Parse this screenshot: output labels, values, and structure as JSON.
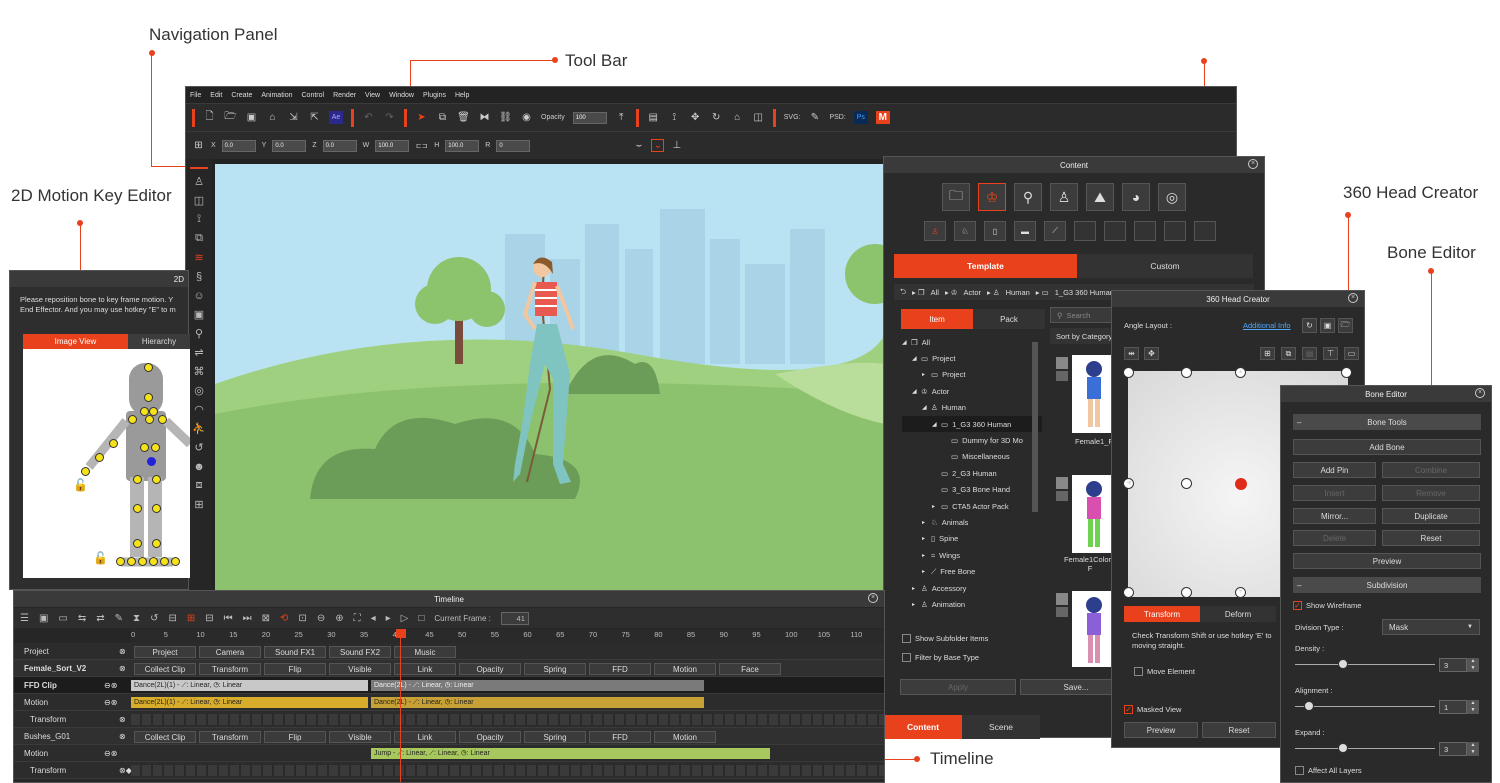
{
  "callouts": {
    "navigation_panel": "Navigation Panel",
    "tool_bar": "Tool Bar",
    "motion_key_editor": "2D Motion Key Editor",
    "head_creator": "360 Head Creator",
    "bone_editor": "Bone Editor",
    "timeline": "Timeline"
  },
  "menu": [
    "File",
    "Edit",
    "Create",
    "Animation",
    "Control",
    "Render",
    "View",
    "Window",
    "Plugins",
    "Help"
  ],
  "toolbar": {
    "opacity_label": "Opacity",
    "opacity_value": "100",
    "svg_label": "SVG:",
    "psd_label": "PSD:",
    "ae_label": "Ae",
    "ps_label": "Ps"
  },
  "transform": {
    "x_label": "X",
    "x_value": "0.0",
    "y_label": "Y",
    "y_value": "0.0",
    "z_label": "Z",
    "z_value": "0.0",
    "w_label": "W",
    "w_value": "100.0",
    "h_label": "H",
    "h_value": "100.0",
    "r_label": "R",
    "r_value": "0"
  },
  "motion_editor": {
    "title": "2D",
    "instruction": "Please reposition bone to key frame motion. Y\nEnd Effector. And you may use hotkey \"E\" to m",
    "tabs": [
      "Image View",
      "Hierarchy"
    ]
  },
  "content": {
    "title": "Content",
    "tabs": [
      "Template",
      "Custom"
    ],
    "breadcrumb": [
      "All",
      "Actor",
      "Human",
      "1_G3 360 Human"
    ],
    "subtabs": [
      "Item",
      "Pack"
    ],
    "search_placeholder": "Search",
    "sort_label": "Sort by Category",
    "tree": [
      {
        "label": "All",
        "indent": 0,
        "arrow": "◢",
        "icon": "❐"
      },
      {
        "label": "Project",
        "indent": 1,
        "arrow": "◢",
        "icon": "▭"
      },
      {
        "label": "Project",
        "indent": 2,
        "arrow": "▸",
        "icon": "▭"
      },
      {
        "label": "Actor",
        "indent": 1,
        "arrow": "◢",
        "icon": "♔"
      },
      {
        "label": "Human",
        "indent": 2,
        "arrow": "◢",
        "icon": "♙"
      },
      {
        "label": "1_G3 360 Human",
        "indent": 3,
        "arrow": "◢",
        "icon": "▭"
      },
      {
        "label": "Dummy for 3D Mo",
        "indent": 4,
        "arrow": "",
        "icon": "▭"
      },
      {
        "label": "Miscellaneous",
        "indent": 4,
        "arrow": "",
        "icon": "▭"
      },
      {
        "label": "2_G3 Human",
        "indent": 3,
        "arrow": "",
        "icon": "▭"
      },
      {
        "label": "3_G3 Bone Hand",
        "indent": 3,
        "arrow": "",
        "icon": "▭"
      },
      {
        "label": "CTA5 Actor Pack",
        "indent": 3,
        "arrow": "▸",
        "icon": "▭"
      },
      {
        "label": "Animals",
        "indent": 2,
        "arrow": "▸",
        "icon": "♘"
      },
      {
        "label": "Spine",
        "indent": 2,
        "arrow": "▸",
        "icon": "▯"
      },
      {
        "label": "Wings",
        "indent": 2,
        "arrow": "▸",
        "icon": "≈"
      },
      {
        "label": "Free Bone",
        "indent": 2,
        "arrow": "▸",
        "icon": "⟋"
      },
      {
        "label": "Accessory",
        "indent": 1,
        "arrow": "▸",
        "icon": "♙"
      },
      {
        "label": "Animation",
        "indent": 1,
        "arrow": "▸",
        "icon": "♙"
      }
    ],
    "thumb_labels": [
      "Female1_F",
      "Female1ColorA\nF",
      ""
    ],
    "show_subfolder": "Show Subfolder Items",
    "filter_base": "Filter by Base Type",
    "apply_label": "Apply",
    "save_label": "Save...",
    "bottom_tabs": [
      "Content",
      "Scene"
    ]
  },
  "head_creator": {
    "title": "360 Head Creator",
    "angle_label": "Angle Layout :",
    "additional_info": "Additional Info",
    "tabs": [
      "Transform",
      "Deform"
    ],
    "hint": "Check Transform Shift or use hotkey 'E' to moving straight.",
    "move_element": "Move Element",
    "masked_view": "Masked View",
    "preview": "Preview",
    "reset": "Reset"
  },
  "bone_editor": {
    "title": "Bone Editor",
    "tools_header": "Bone Tools",
    "add_bone": "Add Bone",
    "add_pin": "Add Pin",
    "combine": "Combine",
    "insert": "Insert",
    "remove": "Remove",
    "mirror": "Mirror...",
    "duplicate": "Duplicate",
    "delete": "Delete",
    "reset": "Reset",
    "preview": "Preview",
    "subdivision_header": "Subdivision",
    "show_wireframe": "Show Wireframe",
    "division_type_label": "Division Type :",
    "division_type_value": "Mask",
    "density_label": "Density :",
    "density_value": "3",
    "density_fraction": 0.34,
    "alignment_label": "Alignment :",
    "alignment_value": "1",
    "alignment_fraction": 0.1,
    "expand_label": "Expand :",
    "expand_value": "3",
    "expand_fraction": 0.34,
    "affect_all": "Affect All Layers"
  },
  "timeline": {
    "title": "Timeline",
    "current_frame_label": "Current Frame :",
    "current_frame": "41",
    "ruler": [
      "0",
      "5",
      "10",
      "15",
      "20",
      "25",
      "30",
      "35",
      "40",
      "45",
      "50",
      "55",
      "60",
      "65",
      "70",
      "75",
      "80",
      "85",
      "90",
      "95",
      "100",
      "105",
      "110",
      "11"
    ],
    "project_row": {
      "name": "Project",
      "cells": [
        "Project",
        "Camera",
        "Sound FX1",
        "Sound FX2",
        "Music"
      ]
    },
    "actor_row": {
      "name": "Female_Sort_V2",
      "cells": [
        "Collect Clip",
        "Transform",
        "Flip",
        "Visible",
        "Link",
        "Opacity",
        "Spring",
        "FFD",
        "Motion",
        "Face"
      ]
    },
    "ffd_row": {
      "name": "FFD Clip",
      "bar1": "Dance(2L)(1) - ⟋: Linear, ◷: Linear",
      "bar2": "Dance(2L) - ⟋: Linear, ◷: Linear"
    },
    "motion_row": {
      "name": "Motion",
      "bar1": "Dance(2L)(1) - ⟋: Linear, ◷: Linear",
      "bar2": "Dance(2L) - ⟋: Linear, ◷: Linear"
    },
    "transform_row": {
      "name": "Transform"
    },
    "bushes_row": {
      "name": "Bushes_G01",
      "cells": [
        "Collect Clip",
        "Transform",
        "Flip",
        "Visible",
        "Link",
        "Opacity",
        "Spring",
        "FFD",
        "Motion"
      ]
    },
    "motion2_row": {
      "name": "Motion",
      "bar": "Jump - ⟋: Linear, ⟋: Linear, ◷: Linear"
    },
    "transform2_row": {
      "name": "Transform"
    }
  },
  "colors": {
    "accent": "#e8411b",
    "panel": "#2a2a2a",
    "sky": "#b9e3f3",
    "grass": "#8fc56f",
    "clip_gray": "#c8c8c8",
    "clip_gold": "#d8ad2b",
    "clip_green": "#a6c85d"
  }
}
